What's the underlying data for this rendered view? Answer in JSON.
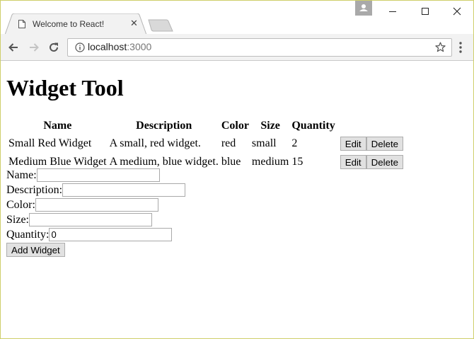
{
  "browser": {
    "tab_title": "Welcome to React!",
    "url_host": "localhost",
    "url_port": ":3000"
  },
  "page": {
    "heading": "Widget Tool",
    "table": {
      "headers": [
        "Name",
        "Description",
        "Color",
        "Size",
        "Quantity"
      ],
      "rows": [
        {
          "name": "Small Red Widget",
          "description": "A small, red widget.",
          "color": "red",
          "size": "small",
          "quantity": "2"
        },
        {
          "name": "Medium Blue Widget",
          "description": "A medium, blue widget.",
          "color": "blue",
          "size": "medium",
          "quantity": "15"
        }
      ],
      "edit_label": "Edit",
      "delete_label": "Delete"
    },
    "form": {
      "name_label": "Name:",
      "name_value": "",
      "description_label": "Description:",
      "description_value": "",
      "color_label": "Color:",
      "color_value": "",
      "size_label": "Size:",
      "size_value": "",
      "quantity_label": "Quantity:",
      "quantity_value": "0",
      "add_label": "Add Widget"
    }
  },
  "icons": {
    "tab": "page-icon",
    "close": "close-icon",
    "back": "back-arrow-icon",
    "forward": "forward-arrow-icon",
    "reload": "reload-icon",
    "info": "info-icon",
    "bookmark": "star-icon",
    "menu": "kebab-menu-icon",
    "profile": "profile-icon",
    "minimize": "minimize-icon",
    "maximize": "maximize-icon",
    "window_close": "window-close-icon"
  }
}
